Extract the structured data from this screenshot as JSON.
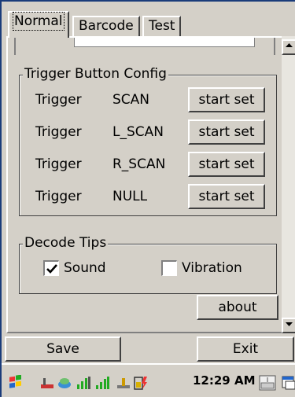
{
  "tabs": [
    {
      "label": "Normal",
      "active": true
    },
    {
      "label": "Barcode",
      "active": false
    },
    {
      "label": "Test",
      "active": false
    }
  ],
  "trigger_config": {
    "title": "Trigger Button Config",
    "rows": [
      {
        "label": "Trigger",
        "mode": "SCAN",
        "button": "start set"
      },
      {
        "label": "Trigger",
        "mode": "L_SCAN",
        "button": "start set"
      },
      {
        "label": "Trigger",
        "mode": "R_SCAN",
        "button": "start set"
      },
      {
        "label": "Trigger",
        "mode": "NULL",
        "button": "start set"
      }
    ]
  },
  "decode_tips": {
    "title": "Decode Tips",
    "sound": {
      "label": "Sound",
      "checked": true
    },
    "vibration": {
      "label": "Vibration",
      "checked": false
    }
  },
  "about_label": "about",
  "footer": {
    "save_label": "Save",
    "exit_label": "Exit"
  },
  "taskbar": {
    "clock": "12:29 AM",
    "icons": [
      "start-flag-icon",
      "usb-icon",
      "network-icon",
      "signal-bars-icon",
      "signal-strength-icon",
      "connection-icon",
      "battery-icon",
      "keyboard-icon",
      "window-icon"
    ]
  }
}
